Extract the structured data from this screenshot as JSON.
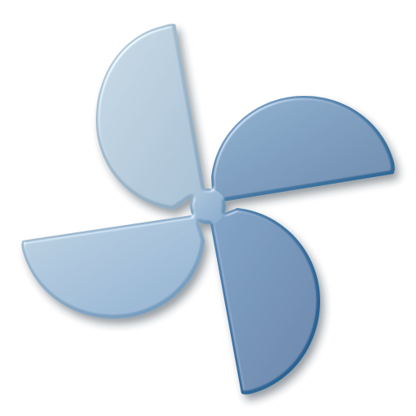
{
  "logo": {
    "icon": "pinwheel-icon",
    "colors": {
      "light_top": "#b2c6d3",
      "light_mid": "#8eaac2",
      "mid": "#6d97bd",
      "dark": "#3a6f9d",
      "darkest": "#1f5a8c",
      "highlight": "#e3ecf2",
      "shadow": "#3f4a55"
    }
  }
}
